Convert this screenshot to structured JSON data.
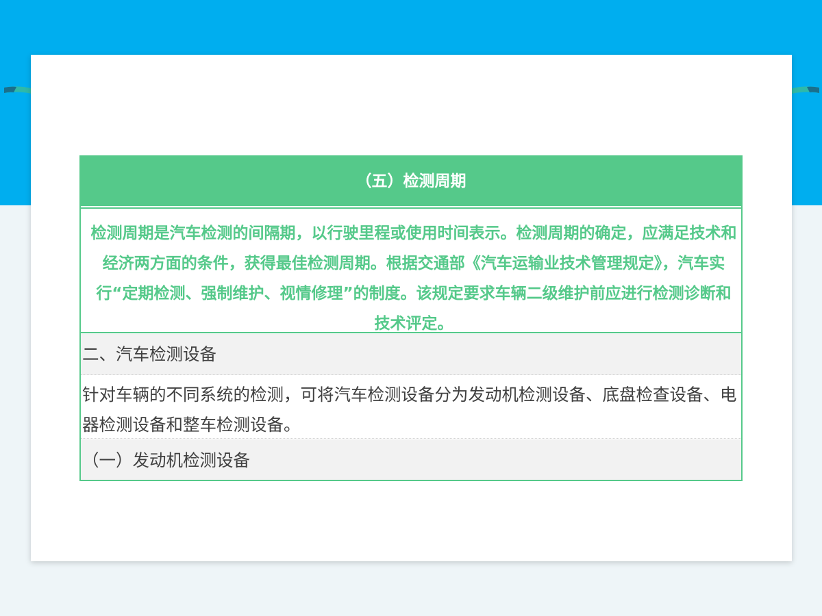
{
  "colors": {
    "top_band": "#00aeef",
    "accent_green": "#55c98a",
    "body_text": "#404040",
    "row_gray": "#f2f2f2",
    "background": "#eef5f8"
  },
  "section": {
    "title": "（五）检测周期",
    "body": "检测周期是汽车检测的间隔期，以行驶里程或使用时间表示。检测周期的确定，应满足技术和经济两方面的条件，获得最佳检测周期。根据交通部《汽车运输业技术管理规定》，汽车实行“定期检测、强制维护、视情修理”的制度。该规定要求车辆二级维护前应进行检测诊断和技术评定。"
  },
  "content": {
    "heading": "二、汽车检测设备",
    "paragraph": "针对车辆的不同系统的检测，可将汽车检测设备分为发动机检测设备、底盘检查设备、电器检测设备和整车检测设备。",
    "subheading": "（一）发动机检测设备"
  }
}
